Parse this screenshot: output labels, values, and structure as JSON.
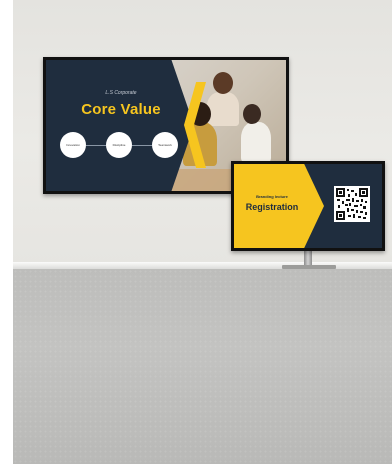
{
  "main_screen": {
    "subtitle": "L.S Corporate",
    "title": "Core Value",
    "values": [
      "Innovation",
      "Discipline",
      "Teamwork"
    ]
  },
  "registration_screen": {
    "subtitle": "Branding lecture",
    "title": "Registration"
  },
  "colors": {
    "navy": "#1f2d3e",
    "yellow": "#f6c51f",
    "wall": "#e8e7e3",
    "counter": "#bdbdbb"
  }
}
